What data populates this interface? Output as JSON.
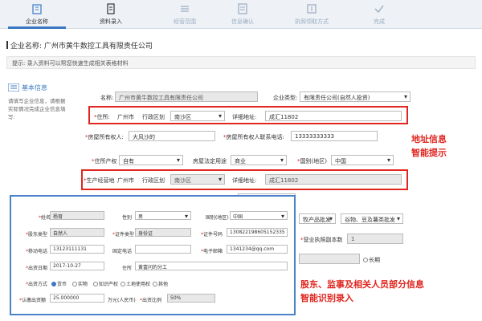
{
  "steps": [
    {
      "label": "企业名称",
      "icon": "building-icon"
    },
    {
      "label": "资料录入",
      "icon": "document-icon"
    },
    {
      "label": "经营范围",
      "icon": "scope-icon"
    },
    {
      "label": "信息确认",
      "icon": "confirm-icon"
    },
    {
      "label": "执照领取方式",
      "icon": "license-icon"
    },
    {
      "label": "完成",
      "icon": "check-icon"
    }
  ],
  "header": {
    "company_label": "企业名称: 广州市黄牛数控工具有限责任公司"
  },
  "tip": "提示: 录入资料可以帮您快速生成相关表格材料",
  "section": {
    "title": "基本信息",
    "desc": "请填写企业信息，请根据实际情况完成企业信息填写:"
  },
  "form": {
    "name_label": "名称:",
    "name_value": "广州市黄牛数控工具有限责任公司",
    "type_label": "企业类型:",
    "type_value": "有限责任公司(自然人投资)",
    "addr_label": "住所:",
    "addr_city": "广州市",
    "addr_district_label": "行政区划",
    "addr_district": "南沙区",
    "addr_detail_label": "详细地址:",
    "addr_detail": "成汇11802",
    "owner_label": "房屋所有权人:",
    "owner_value": "大风沙的",
    "owner_phone_label": "房屋所有权人联系电话:",
    "owner_phone": "13333333333",
    "ownership_label": "住所产权",
    "ownership_value": "自有",
    "usage_label": "房屋法定用途",
    "usage_value": "商业",
    "country_label": "国别(地区)",
    "country_value": "中国",
    "biz_addr_label": "生产经营地",
    "biz_city": "广州市",
    "biz_district_label": "行政区划",
    "biz_district": "南沙区",
    "biz_detail_label": "详细地址:",
    "biz_detail": "成汇11802",
    "industry_value": "牧产品批发",
    "industry_sub": "谷物、豆及薯类批发",
    "copies_label": "营业执照副本数",
    "copies_value": "1",
    "long_term": "长期"
  },
  "popup": {
    "name_label": "姓名",
    "name_value": "杨育",
    "gender_label": "性别",
    "gender_value": "男",
    "country_label": "国别(地区)",
    "country_value": "中国",
    "holder_type_label": "股东类型",
    "holder_type_value": "自然人",
    "id_type_label": "证件类型",
    "id_type_value": "身份证",
    "id_no_label": "证件号码",
    "id_no_value": "130822198605152335",
    "mobile_label": "移动电话",
    "mobile_value": "13123111131",
    "phone_label": "固定电话",
    "phone_value": "",
    "email_label": "电子邮箱",
    "email_value": "1341234@qq.com",
    "date_label": "出资日期",
    "date_value": "2017-10-27",
    "addr_label": "住所",
    "addr_value": "黄富问的分工",
    "method_label": "出资方式",
    "methods": [
      {
        "label": "货币",
        "on": true
      },
      {
        "label": "实物",
        "on": false
      },
      {
        "label": "知识产权",
        "on": false
      },
      {
        "label": "土地使用权",
        "on": false
      },
      {
        "label": "其他",
        "on": false
      }
    ],
    "amount_label": "认缴出资额",
    "amount_value": "25.000000",
    "unit": "万元(人民币)",
    "ratio_label": "出资比例",
    "ratio_value": "50%"
  },
  "annotations": {
    "addr_line1": "地址信息",
    "addr_line2": "智能提示",
    "people_line1": "股东、监事及相关人员部分信息",
    "people_line2": "智能识别录入"
  },
  "colors": {
    "accent": "#3a78c3",
    "annotation": "#e0261f"
  }
}
